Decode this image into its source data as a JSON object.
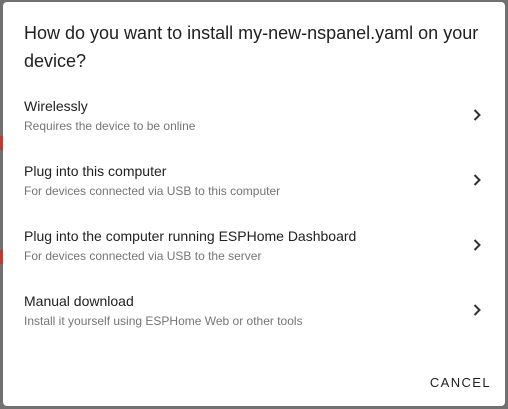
{
  "dialog": {
    "title": "How do you want to install my-new-nspanel.yaml on your device?",
    "options": [
      {
        "label": "Wirelessly",
        "description": "Requires the device to be online",
        "icon": "chevron-right-icon"
      },
      {
        "label": "Plug into this computer",
        "description": "For devices connected via USB to this computer",
        "icon": "chevron-right-icon"
      },
      {
        "label": "Plug into the computer running ESPHome Dashboard",
        "description": "For devices connected via USB to the server",
        "icon": "chevron-right-icon"
      },
      {
        "label": "Manual download",
        "description": "Install it yourself using ESPHome Web or other tools",
        "icon": "chevron-right-icon"
      }
    ],
    "cancel_label": "CANCEL"
  },
  "colors": {
    "backdrop": "#707070",
    "surface": "#ffffff",
    "primary_text": "#212121",
    "secondary_text": "#757575",
    "edge_accent": "#c0392b"
  }
}
